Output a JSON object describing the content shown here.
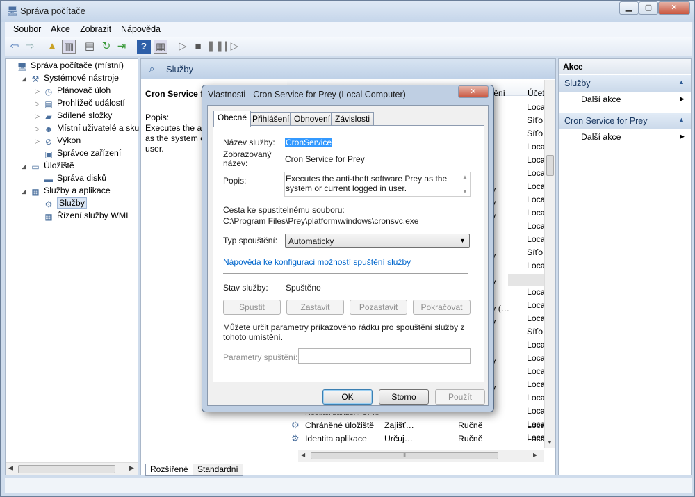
{
  "window": {
    "title": "Správa počítače",
    "min": "▁",
    "max": "▢",
    "close": "✕"
  },
  "menu": [
    "Soubor",
    "Akce",
    "Zobrazit",
    "Nápověda"
  ],
  "toolbar_icons": [
    "back-icon",
    "forward-icon",
    "up-folder-icon",
    "show-hide-tree-icon",
    "properties-icon",
    "refresh-icon",
    "export-icon",
    "help-icon",
    "show-pane-icon",
    "play-icon",
    "stop-icon",
    "pause-icon",
    "restart-icon"
  ],
  "tree": [
    {
      "label": "Správa počítače (místní)",
      "level": 0,
      "exp": "",
      "icon": "computer-icon",
      "glyph": "🖥"
    },
    {
      "label": "Systémové nástroje",
      "level": 1,
      "exp": "◢",
      "icon": "tools-icon",
      "glyph": "⚒"
    },
    {
      "label": "Plánovač úloh",
      "level": 2,
      "exp": "▷",
      "icon": "clock-icon",
      "glyph": "◷"
    },
    {
      "label": "Prohlížeč událostí",
      "level": 2,
      "exp": "▷",
      "icon": "event-viewer-icon",
      "glyph": "▤"
    },
    {
      "label": "Sdílené složky",
      "level": 2,
      "exp": "▷",
      "icon": "shared-folder-icon",
      "glyph": "▰"
    },
    {
      "label": "Místní uživatelé a skupiny",
      "level": 2,
      "exp": "▷",
      "icon": "users-icon",
      "glyph": "☻"
    },
    {
      "label": "Výkon",
      "level": 2,
      "exp": "▷",
      "icon": "performance-icon",
      "glyph": "⊘"
    },
    {
      "label": "Správce zařízení",
      "level": 2,
      "exp": "",
      "icon": "device-manager-icon",
      "glyph": "▣"
    },
    {
      "label": "Úložiště",
      "level": 1,
      "exp": "◢",
      "icon": "storage-icon",
      "glyph": "▭"
    },
    {
      "label": "Správa disků",
      "level": 2,
      "exp": "",
      "icon": "disk-icon",
      "glyph": "▬"
    },
    {
      "label": "Služby a aplikace",
      "level": 1,
      "exp": "◢",
      "icon": "services-apps-icon",
      "glyph": "▦"
    },
    {
      "label": "Služby",
      "level": 2,
      "exp": "",
      "icon": "services-gear-icon",
      "glyph": "⚙",
      "selected": true
    },
    {
      "label": "Řízení služby WMI",
      "level": 2,
      "exp": "",
      "icon": "wmi-icon",
      "glyph": "▦"
    }
  ],
  "center": {
    "header_title": "Služby",
    "selected_service_title": "Cron Service for Prey",
    "desc_label": "Popis:",
    "desc_text": [
      "Executes the anti-",
      "as the system o",
      "user."
    ],
    "columns": {
      "status": "tění",
      "account": "Účet"
    },
    "tabs": [
      "Rozšířené",
      "Standardní"
    ],
    "col_status_rows": [
      "",
      "",
      "",
      "ky",
      "ky",
      "ky",
      "",
      "",
      "ky",
      "",
      "ky",
      "",
      "ky (…",
      "ky",
      "",
      "",
      "ky",
      "",
      "ky",
      ""
    ],
    "col_account_rows": [
      "Loca",
      "Síťo",
      "Síťo",
      "Loca",
      "Loca",
      "Loca",
      "Loca",
      "Loca",
      "Loca",
      "Loca",
      "Loca",
      "Síťo",
      "Loca",
      "Loca",
      "Loca",
      "Loca",
      "Loca",
      "Síťo",
      "Loca",
      "Loca",
      "Loca",
      "Loca",
      "Loca",
      "Loca",
      "Loca",
      "Loca"
    ],
    "visible_rows": [
      {
        "name": "Chráněné úložiště",
        "description": "Zajišť…",
        "startup": "Ručně",
        "account": "Loca"
      },
      {
        "name": "Identita aplikace",
        "description": "Určuj…",
        "startup": "Ručně",
        "account": "Loca"
      }
    ],
    "partial_row_text": "Hostitel zařízení UPnP"
  },
  "actions": {
    "header": "Akce",
    "sections": [
      {
        "title": "Služby",
        "item": "Další akce"
      },
      {
        "title": "Cron Service for Prey",
        "item": "Další akce"
      }
    ]
  },
  "dialog": {
    "title": "Vlastnosti - Cron Service for Prey (Local Computer)",
    "tabs": [
      "Obecné",
      "Přihlášení",
      "Obnovení",
      "Závislosti"
    ],
    "service_name_label": "Název služby:",
    "service_name_value": "CronService",
    "display_name_label_1": "Zobrazovaný",
    "display_name_label_2": "název:",
    "display_name_value": "Cron Service for Prey",
    "description_label": "Popis:",
    "description_value": "Executes the anti-theft software Prey as the system or current logged in user.",
    "path_label": "Cesta ke spustitelnému souboru:",
    "path_value": "C:\\Program Files\\Prey\\platform\\windows\\cronsvc.exe",
    "startup_type_label": "Typ spouštění:",
    "startup_type_value": "Automaticky",
    "help_link": "Nápověda ke konfiguraci možností spuštění služby",
    "status_label": "Stav služby:",
    "status_value": "Spuštěno",
    "start_btn": "Spustit",
    "stop_btn": "Zastavit",
    "pause_btn": "Pozastavit",
    "continue_btn": "Pokračovat",
    "params_note": "Můžete určit parametry příkazového řádku pro spouštění služby z tohoto umístění.",
    "params_label": "Parametry spuštění:",
    "params_value": "",
    "ok_btn": "OK",
    "cancel_btn": "Storno",
    "apply_btn": "Použít",
    "close": "✕"
  },
  "colors": {
    "accent": "#3c7fb1",
    "link": "#0066cc",
    "selection": "#3399ff"
  }
}
